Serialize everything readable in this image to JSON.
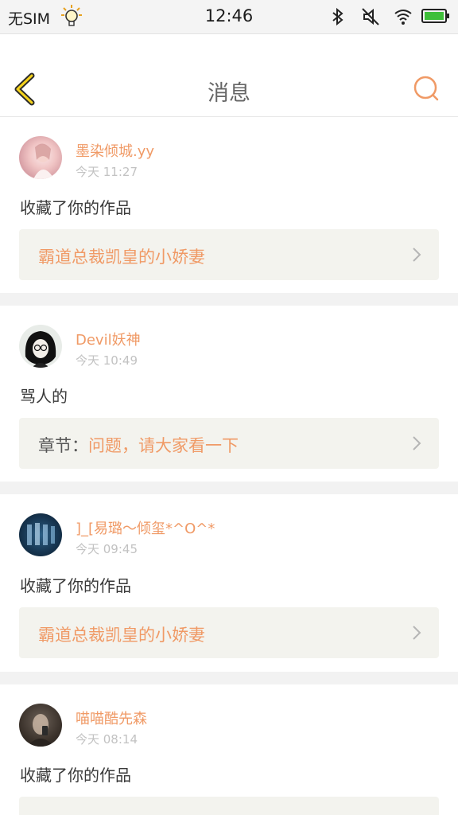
{
  "status_bar": {
    "carrier": "无SIM",
    "time": "12:46",
    "icons": [
      "light-bulb-icon",
      "bluetooth-icon",
      "mute-icon",
      "wifi-icon",
      "battery-icon"
    ]
  },
  "nav": {
    "title": "消息",
    "back_icon": "chevron-left-icon",
    "search_icon": "search-icon",
    "accent": "#f09a66"
  },
  "messages": [
    {
      "username": "墨染倾城.yy",
      "time": "今天 11:27",
      "action": "收藏了你的作品",
      "ref_prefix": "",
      "ref_title": "霸道总裁凯皇的小娇妻"
    },
    {
      "username": "Devil妖神",
      "time": "今天 10:49",
      "action": "骂人的",
      "ref_prefix": "章节：",
      "ref_title": "问题，请大家看一下"
    },
    {
      "username": "]_[易璐～倾玺*^O^*",
      "time": "今天 09:45",
      "action": "收藏了你的作品",
      "ref_prefix": "",
      "ref_title": "霸道总裁凯皇的小娇妻"
    },
    {
      "username": "喵喵酷先森",
      "time": "今天 08:14",
      "action": "收藏了你的作品",
      "ref_prefix": "",
      "ref_title": ""
    }
  ]
}
